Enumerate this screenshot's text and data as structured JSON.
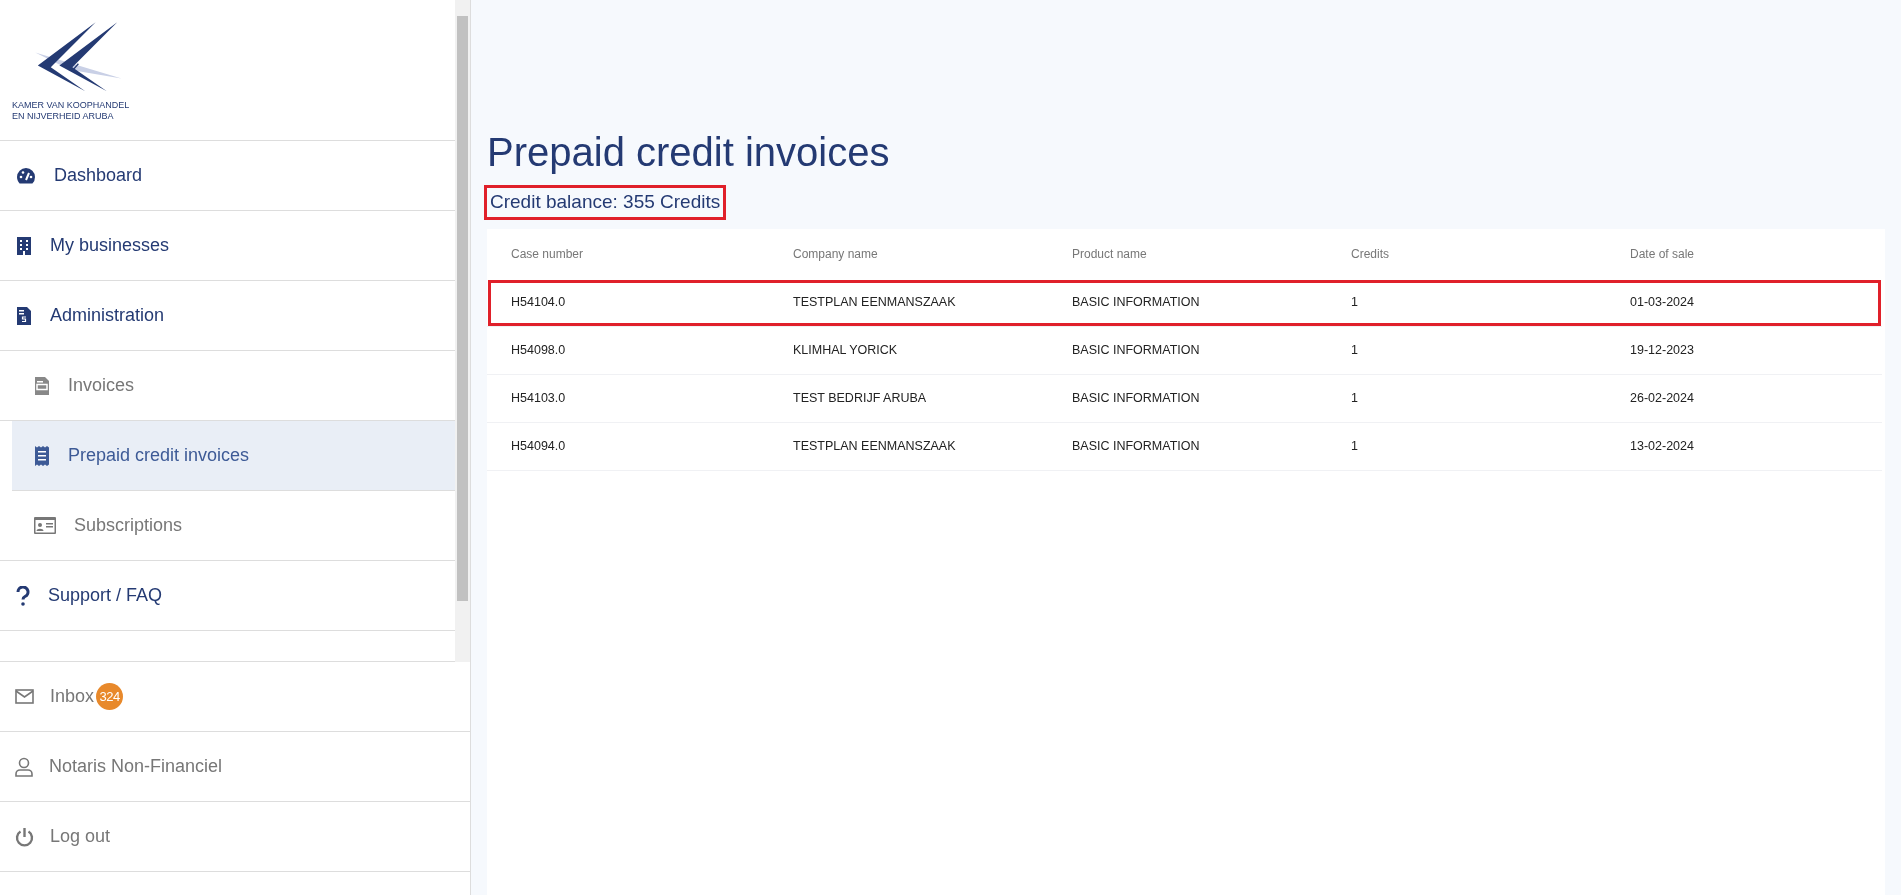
{
  "logo": {
    "lines": [
      "KAMER VAN KOOPHANDEL",
      "EN NIJVERHEID ARUBA"
    ]
  },
  "sidebar": {
    "items": [
      {
        "label": "Dashboard",
        "kind": "parent",
        "selected": false
      },
      {
        "label": "My businesses",
        "kind": "parent",
        "selected": false
      },
      {
        "label": "Administration",
        "kind": "parent",
        "selected": false
      },
      {
        "label": "Invoices",
        "kind": "child",
        "selected": false
      },
      {
        "label": "Prepaid credit invoices",
        "kind": "child",
        "selected": true
      },
      {
        "label": "Subscriptions",
        "kind": "child",
        "selected": false
      },
      {
        "label": "Support / FAQ",
        "kind": "parent",
        "selected": false
      }
    ],
    "bottom_items": [
      {
        "label": "Inbox",
        "badge": "324"
      },
      {
        "label": "Notaris Non-Financiel"
      },
      {
        "label": "Log out"
      }
    ]
  },
  "page": {
    "title": "Prepaid credit invoices",
    "balance": {
      "text": "Credit balance: 355 Credits",
      "highlighted": true
    }
  },
  "table": {
    "columns": [
      "Case number",
      "Company name",
      "Product name",
      "Credits",
      "Date of sale"
    ],
    "rows": [
      {
        "cells": [
          "H54104.0",
          "TESTPLAN EENMANSZAAK",
          "BASIC INFORMATION",
          "1",
          "01-03-2024"
        ],
        "highlighted": true
      },
      {
        "cells": [
          "H54098.0",
          "KLIMHAL YORICK",
          "BASIC INFORMATION",
          "1",
          "19-12-2023"
        ],
        "highlighted": false
      },
      {
        "cells": [
          "H54103.0",
          "TEST BEDRIJF ARUBA",
          "BASIC INFORMATION",
          "1",
          "26-02-2024"
        ],
        "highlighted": false
      },
      {
        "cells": [
          "H54094.0",
          "TESTPLAN EENMANSZAAK",
          "BASIC INFORMATION",
          "1",
          "13-02-2024"
        ],
        "highlighted": false
      }
    ]
  }
}
